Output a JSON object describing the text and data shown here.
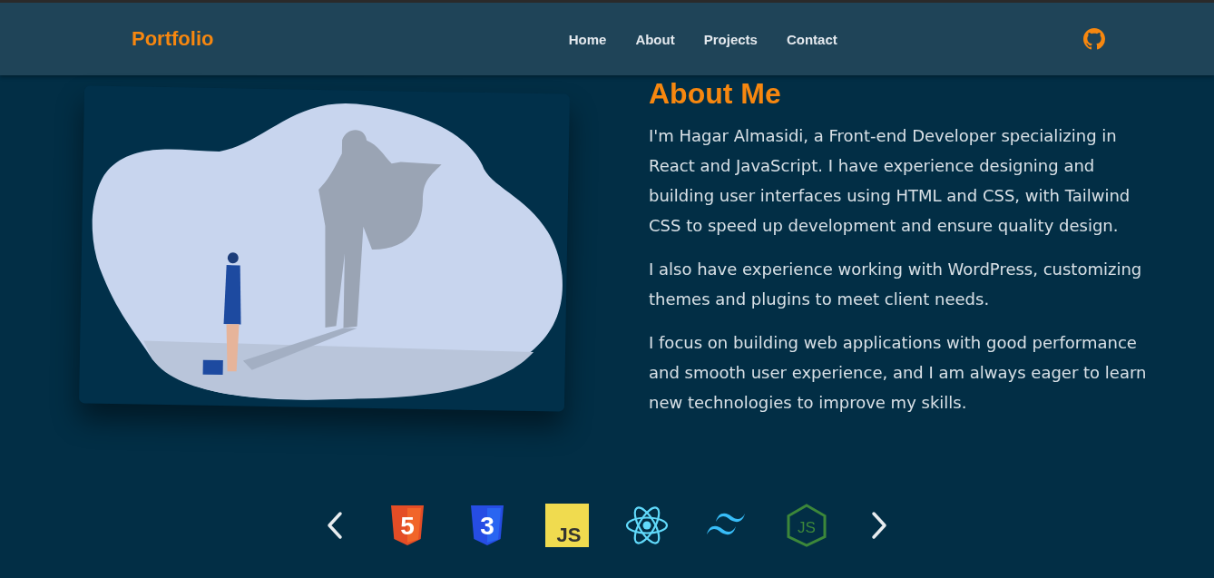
{
  "header": {
    "logo": "Portfolio",
    "nav": [
      {
        "label": "Home"
      },
      {
        "label": "About"
      },
      {
        "label": "Projects"
      },
      {
        "label": "Contact"
      }
    ]
  },
  "about": {
    "title": "About Me",
    "paragraphs": [
      "I'm Hagar Almasidi, a Front-end Developer specializing in React and JavaScript. I have experience designing and building user interfaces using HTML and CSS, with Tailwind CSS to speed up development and ensure quality design.",
      "I also have experience working with WordPress, customizing themes and plugins to meet client needs.",
      "I focus on building web applications with good performance and smooth user experience, and I am always eager to learn new technologies to improve my skills."
    ]
  },
  "skills": [
    {
      "kind": "html5",
      "mark": "5"
    },
    {
      "kind": "css3",
      "mark": "3"
    },
    {
      "kind": "javascript",
      "mark": "JS"
    },
    {
      "kind": "react"
    },
    {
      "kind": "tailwind"
    },
    {
      "kind": "nodejs",
      "mark": "JS"
    }
  ]
}
